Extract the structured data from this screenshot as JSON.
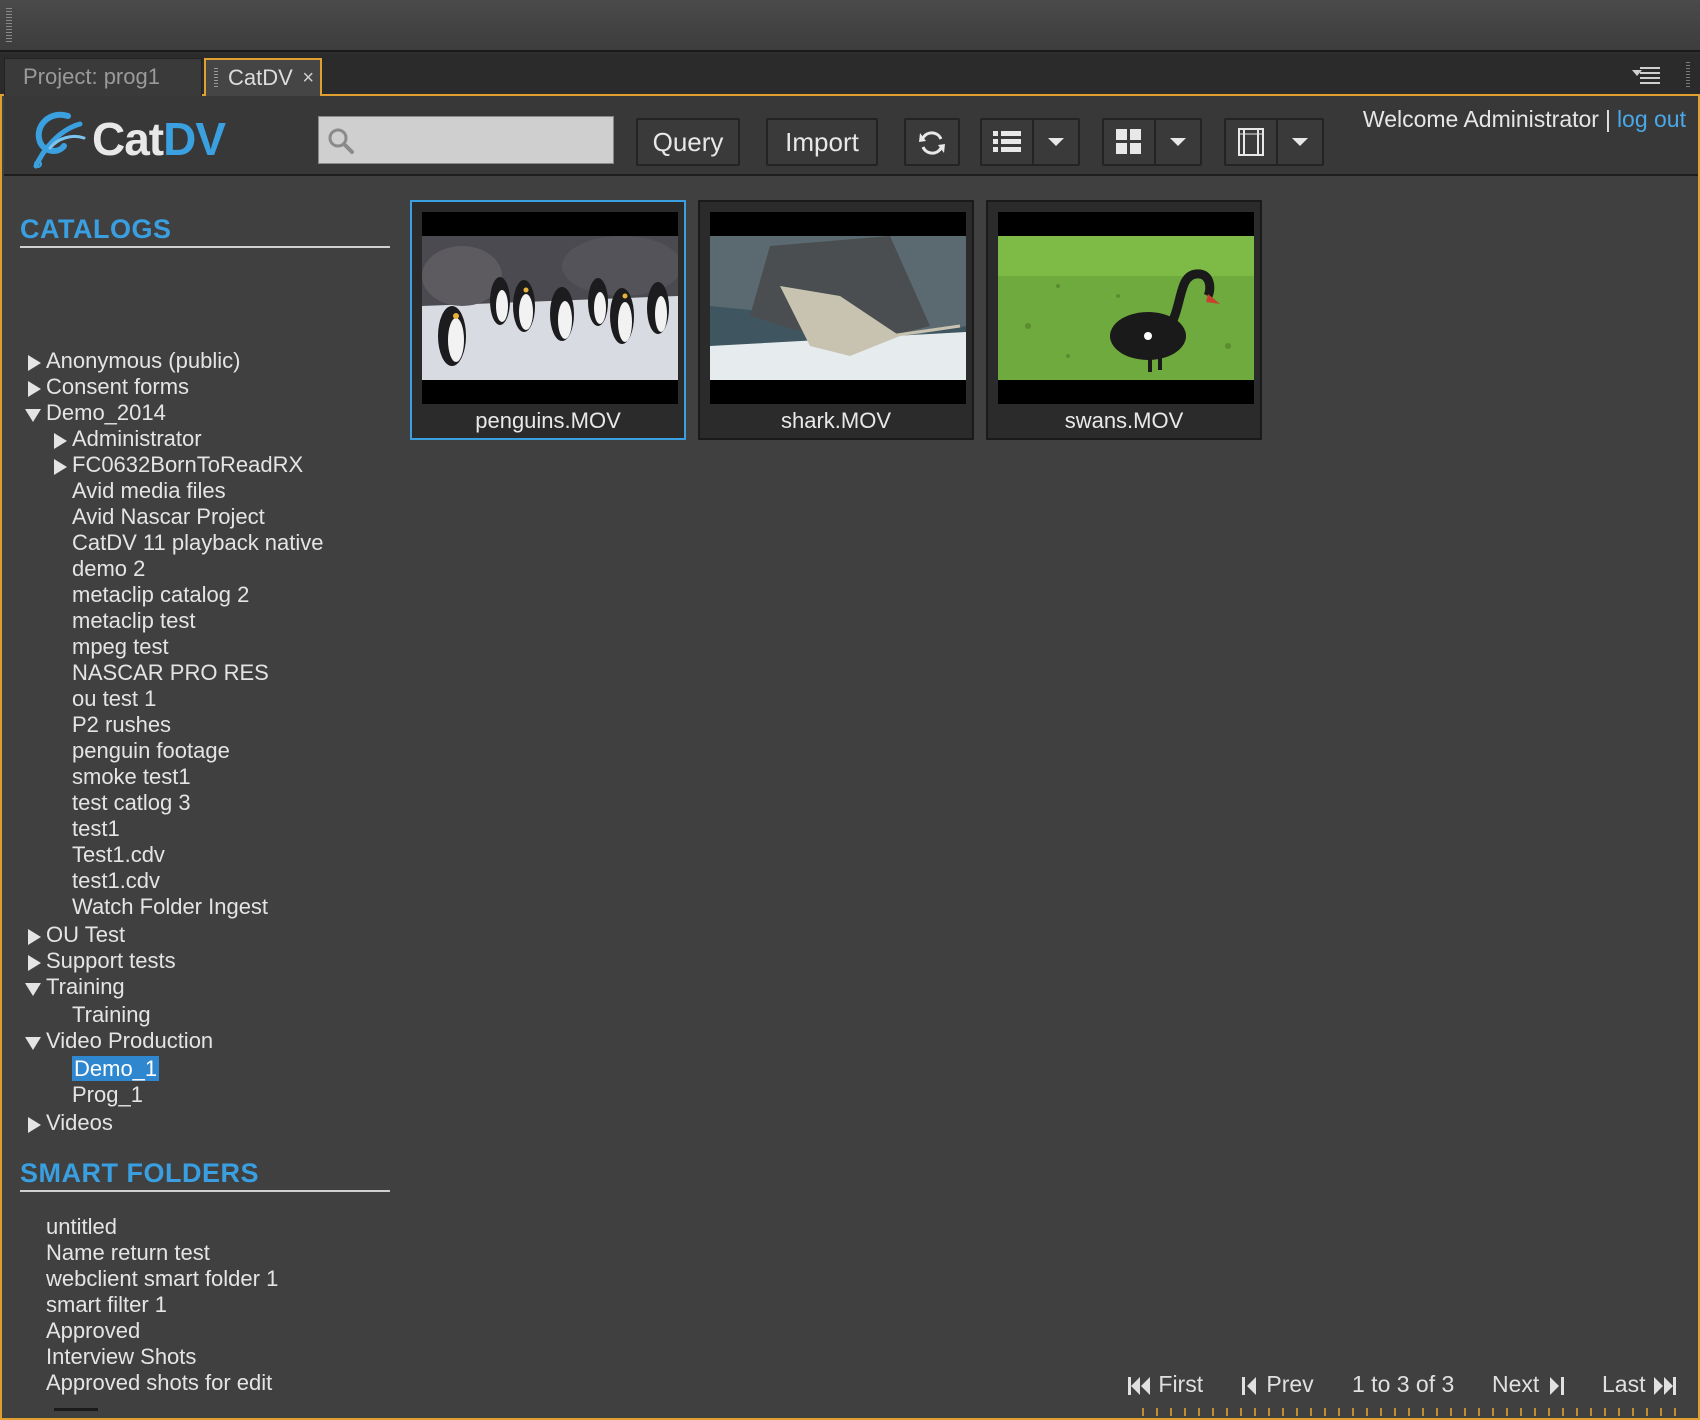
{
  "tabs": [
    {
      "label": "Project: prog1",
      "active": false
    },
    {
      "label": "CatDV",
      "active": true,
      "close": "×"
    }
  ],
  "logo": {
    "cat": "Cat",
    "dv": "DV"
  },
  "search": {
    "placeholder": "",
    "value": ""
  },
  "toolbar": {
    "query_label": "Query",
    "import_label": "Import",
    "refresh_icon": "refresh-icon",
    "list_view_icon": "list-view-icon",
    "grid_view_icon": "grid-view-icon",
    "filmstrip_view_icon": "filmstrip-view-icon"
  },
  "user": {
    "welcome": "Welcome Administrator",
    "separator": "|",
    "logout": "log out"
  },
  "sidebar": {
    "catalogs_title": "CATALOGS",
    "catalogs": [
      {
        "label": "Anonymous (public)",
        "level": 0,
        "arrow": "right"
      },
      {
        "label": "Consent forms",
        "level": 0,
        "arrow": "right"
      },
      {
        "label": "Demo_2014",
        "level": 0,
        "arrow": "down"
      },
      {
        "label": "Administrator",
        "level": 1,
        "arrow": "right"
      },
      {
        "label": "FC0632BornToReadRX",
        "level": 1,
        "arrow": "right"
      },
      {
        "label": "Avid media files",
        "level": 1,
        "arrow": ""
      },
      {
        "label": "Avid Nascar Project",
        "level": 1,
        "arrow": ""
      },
      {
        "label": "CatDV 11 playback native",
        "level": 1,
        "arrow": ""
      },
      {
        "label": "demo 2",
        "level": 1,
        "arrow": ""
      },
      {
        "label": "metaclip catalog 2",
        "level": 1,
        "arrow": ""
      },
      {
        "label": "metaclip test",
        "level": 1,
        "arrow": ""
      },
      {
        "label": "mpeg test",
        "level": 1,
        "arrow": ""
      },
      {
        "label": "NASCAR PRO RES",
        "level": 1,
        "arrow": ""
      },
      {
        "label": "ou test 1",
        "level": 1,
        "arrow": ""
      },
      {
        "label": "P2 rushes",
        "level": 1,
        "arrow": ""
      },
      {
        "label": "penguin footage",
        "level": 1,
        "arrow": ""
      },
      {
        "label": "smoke test1",
        "level": 1,
        "arrow": ""
      },
      {
        "label": "test catlog 3",
        "level": 1,
        "arrow": ""
      },
      {
        "label": "test1",
        "level": 1,
        "arrow": ""
      },
      {
        "label": "Test1.cdv",
        "level": 1,
        "arrow": ""
      },
      {
        "label": "test1.cdv",
        "level": 1,
        "arrow": ""
      },
      {
        "label": "Watch Folder Ingest",
        "level": 1,
        "arrow": ""
      },
      {
        "label": "OU Test",
        "level": 0,
        "arrow": "right"
      },
      {
        "label": "Support tests",
        "level": 0,
        "arrow": "right"
      },
      {
        "label": "Training",
        "level": 0,
        "arrow": "down"
      },
      {
        "label": "Training",
        "level": 1,
        "arrow": ""
      },
      {
        "label": "Video Production",
        "level": 0,
        "arrow": "down"
      },
      {
        "label": "Demo_1",
        "level": 1,
        "arrow": "",
        "selected": true
      },
      {
        "label": "Prog_1",
        "level": 1,
        "arrow": ""
      },
      {
        "label": "Videos",
        "level": 0,
        "arrow": "right"
      }
    ],
    "smart_title": "SMART FOLDERS",
    "smart_folders": [
      "untitled",
      "Name return test",
      "webclient smart folder 1",
      "smart filter 1",
      "Approved",
      "Interview Shots",
      "Approved shots for edit"
    ]
  },
  "clips": [
    {
      "name": "penguins.MOV",
      "selected": true,
      "thumbnail": "penguins"
    },
    {
      "name": "shark.MOV",
      "selected": false,
      "thumbnail": "stingray"
    },
    {
      "name": "swans.MOV",
      "selected": false,
      "thumbnail": "black-swan"
    }
  ],
  "pager": {
    "first": "First",
    "prev": "Prev",
    "range": "1 to 3 of 3",
    "next": "Next",
    "last": "Last"
  },
  "colors": {
    "accent": "#3a9fe0",
    "frame": "#e0a030",
    "background": "#404040"
  }
}
